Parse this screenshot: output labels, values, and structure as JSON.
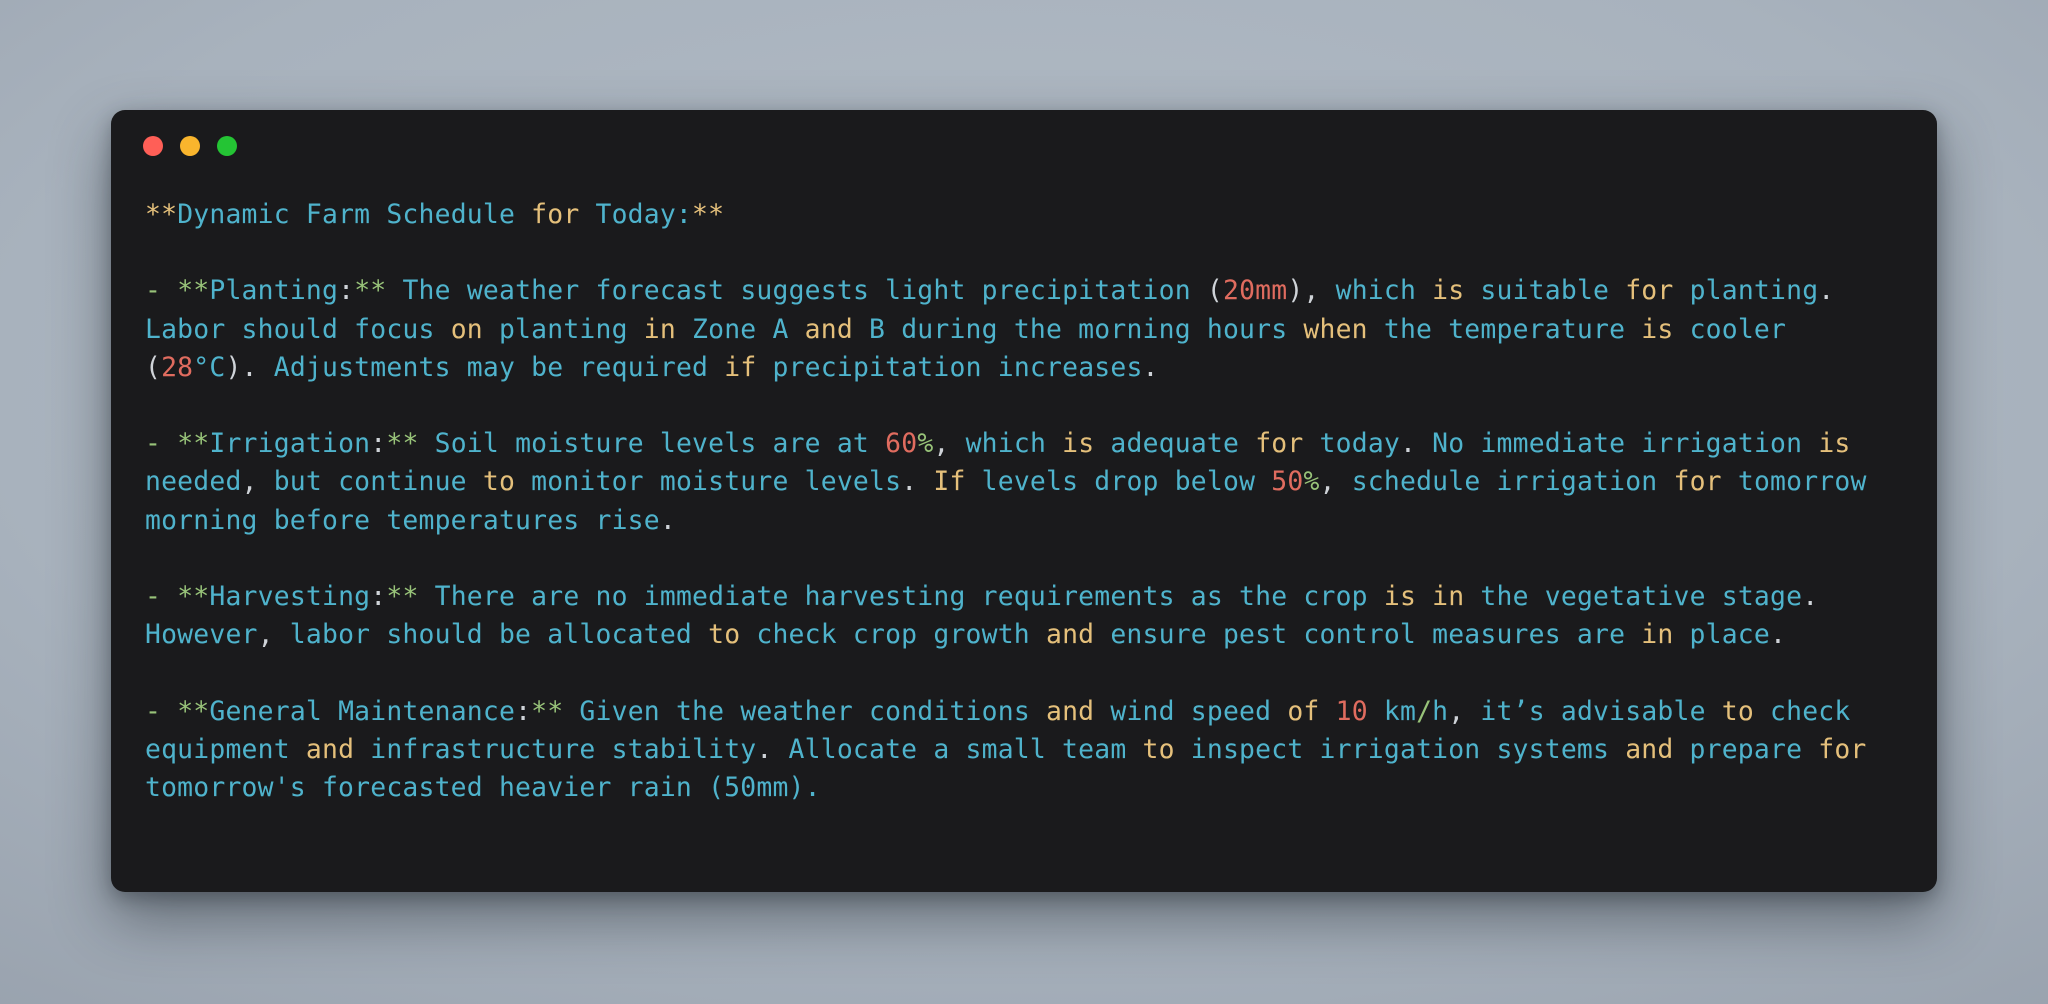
{
  "window": {
    "title": "",
    "controls": [
      {
        "name": "close-button",
        "color": "#ff5f57"
      },
      {
        "name": "minimize-button",
        "color": "#f9b52d"
      },
      {
        "name": "maximize-button",
        "color": "#24c434"
      }
    ]
  },
  "theme": {
    "background": "#1a1a1c",
    "desktop": "#a8b2bd",
    "text": "#4fb3cc",
    "keyword": "#e5c07b",
    "accent_green": "#98c379",
    "number": "#e06c5f",
    "punctuation": "#cfd3d8"
  },
  "terminal": {
    "lines": [
      {
        "id": "heading",
        "tokens": [
          {
            "text": "**",
            "cls": "t-kw"
          },
          {
            "text": "Dynamic Farm Schedule ",
            "cls": "t-txt"
          },
          {
            "text": "for",
            "cls": "t-kw"
          },
          {
            "text": " Today:",
            "cls": "t-txt"
          },
          {
            "text": "**",
            "cls": "t-kw"
          }
        ]
      },
      {
        "id": "blank-1",
        "blank": true
      },
      {
        "id": "planting",
        "tokens": [
          {
            "text": "- ",
            "cls": "t-grn"
          },
          {
            "text": "**",
            "cls": "t-grn"
          },
          {
            "text": "Planting",
            "cls": "t-txt"
          },
          {
            "text": ":",
            "cls": "t-pun"
          },
          {
            "text": "**",
            "cls": "t-grn"
          },
          {
            "text": " The weather forecast suggests light precipitation ",
            "cls": "t-txt"
          },
          {
            "text": "(",
            "cls": "t-pun"
          },
          {
            "text": "20mm",
            "cls": "t-num"
          },
          {
            "text": "), ",
            "cls": "t-pun"
          },
          {
            "text": "which ",
            "cls": "t-txt"
          },
          {
            "text": "is",
            "cls": "t-kw"
          },
          {
            "text": " suitable ",
            "cls": "t-txt"
          },
          {
            "text": "for",
            "cls": "t-kw"
          },
          {
            "text": " planting",
            "cls": "t-txt"
          },
          {
            "text": ".",
            "cls": "t-pun"
          },
          {
            "text": " Labor should focus ",
            "cls": "t-txt"
          },
          {
            "text": "on",
            "cls": "t-kw"
          },
          {
            "text": " planting ",
            "cls": "t-txt"
          },
          {
            "text": "in",
            "cls": "t-kw"
          },
          {
            "text": " Zone A ",
            "cls": "t-txt"
          },
          {
            "text": "and",
            "cls": "t-kw"
          },
          {
            "text": " B during the morning hours ",
            "cls": "t-txt"
          },
          {
            "text": "when",
            "cls": "t-kw"
          },
          {
            "text": " the temperature ",
            "cls": "t-txt"
          },
          {
            "text": "is",
            "cls": "t-kw"
          },
          {
            "text": " cooler ",
            "cls": "t-txt"
          },
          {
            "text": "(",
            "cls": "t-pun"
          },
          {
            "text": "28",
            "cls": "t-num"
          },
          {
            "text": "°C",
            "cls": "t-txt"
          },
          {
            "text": ").",
            "cls": "t-pun"
          },
          {
            "text": " Adjustments may be required ",
            "cls": "t-txt"
          },
          {
            "text": "if",
            "cls": "t-kw"
          },
          {
            "text": " precipitation increases",
            "cls": "t-txt"
          },
          {
            "text": ".",
            "cls": "t-pun"
          }
        ]
      },
      {
        "id": "blank-2",
        "blank": true
      },
      {
        "id": "irrigation",
        "tokens": [
          {
            "text": "- ",
            "cls": "t-grn"
          },
          {
            "text": "**",
            "cls": "t-grn"
          },
          {
            "text": "Irrigation",
            "cls": "t-txt"
          },
          {
            "text": ":",
            "cls": "t-pun"
          },
          {
            "text": "**",
            "cls": "t-grn"
          },
          {
            "text": " Soil moisture levels are at ",
            "cls": "t-txt"
          },
          {
            "text": "60",
            "cls": "t-num"
          },
          {
            "text": "%",
            "cls": "t-grn"
          },
          {
            "text": ", ",
            "cls": "t-pun"
          },
          {
            "text": "which ",
            "cls": "t-txt"
          },
          {
            "text": "is",
            "cls": "t-kw"
          },
          {
            "text": " adequate ",
            "cls": "t-txt"
          },
          {
            "text": "for",
            "cls": "t-kw"
          },
          {
            "text": " today",
            "cls": "t-txt"
          },
          {
            "text": ".",
            "cls": "t-pun"
          },
          {
            "text": " No immediate irrigation ",
            "cls": "t-txt"
          },
          {
            "text": "is",
            "cls": "t-kw"
          },
          {
            "text": " needed",
            "cls": "t-txt"
          },
          {
            "text": ",",
            "cls": "t-pun"
          },
          {
            "text": " but continue ",
            "cls": "t-txt"
          },
          {
            "text": "to",
            "cls": "t-kw"
          },
          {
            "text": " monitor moisture levels",
            "cls": "t-txt"
          },
          {
            "text": ".",
            "cls": "t-pun"
          },
          {
            "text": " ",
            "cls": "t-txt"
          },
          {
            "text": "If",
            "cls": "t-kw"
          },
          {
            "text": " levels drop below ",
            "cls": "t-txt"
          },
          {
            "text": "50",
            "cls": "t-num"
          },
          {
            "text": "%",
            "cls": "t-grn"
          },
          {
            "text": ", ",
            "cls": "t-pun"
          },
          {
            "text": "schedule irrigation ",
            "cls": "t-txt"
          },
          {
            "text": "for",
            "cls": "t-kw"
          },
          {
            "text": " tomorrow morning before temperatures rise",
            "cls": "t-txt"
          },
          {
            "text": ".",
            "cls": "t-pun"
          }
        ]
      },
      {
        "id": "blank-3",
        "blank": true
      },
      {
        "id": "harvesting",
        "tokens": [
          {
            "text": "- ",
            "cls": "t-grn"
          },
          {
            "text": "**",
            "cls": "t-grn"
          },
          {
            "text": "Harvesting",
            "cls": "t-txt"
          },
          {
            "text": ":",
            "cls": "t-pun"
          },
          {
            "text": "**",
            "cls": "t-grn"
          },
          {
            "text": " There are no immediate harvesting requirements as the crop ",
            "cls": "t-txt"
          },
          {
            "text": "is",
            "cls": "t-kw"
          },
          {
            "text": " ",
            "cls": "t-txt"
          },
          {
            "text": "in",
            "cls": "t-kw"
          },
          {
            "text": " the vegetative stage",
            "cls": "t-txt"
          },
          {
            "text": ".",
            "cls": "t-pun"
          },
          {
            "text": " However",
            "cls": "t-txt"
          },
          {
            "text": ",",
            "cls": "t-pun"
          },
          {
            "text": " labor should be allocated ",
            "cls": "t-txt"
          },
          {
            "text": "to",
            "cls": "t-kw"
          },
          {
            "text": " check crop growth ",
            "cls": "t-txt"
          },
          {
            "text": "and",
            "cls": "t-kw"
          },
          {
            "text": " ensure pest control measures are ",
            "cls": "t-txt"
          },
          {
            "text": "in",
            "cls": "t-kw"
          },
          {
            "text": " place",
            "cls": "t-txt"
          },
          {
            "text": ".",
            "cls": "t-pun"
          }
        ]
      },
      {
        "id": "blank-4",
        "blank": true
      },
      {
        "id": "general-maintenance",
        "tokens": [
          {
            "text": "- ",
            "cls": "t-grn"
          },
          {
            "text": "**",
            "cls": "t-grn"
          },
          {
            "text": "General Maintenance",
            "cls": "t-txt"
          },
          {
            "text": ":",
            "cls": "t-pun"
          },
          {
            "text": "**",
            "cls": "t-grn"
          },
          {
            "text": " Given the weather conditions ",
            "cls": "t-txt"
          },
          {
            "text": "and",
            "cls": "t-kw"
          },
          {
            "text": " wind speed ",
            "cls": "t-txt"
          },
          {
            "text": "of",
            "cls": "t-kw"
          },
          {
            "text": " ",
            "cls": "t-txt"
          },
          {
            "text": "10",
            "cls": "t-num"
          },
          {
            "text": " km",
            "cls": "t-txt"
          },
          {
            "text": "/",
            "cls": "t-grn"
          },
          {
            "text": "h",
            "cls": "t-txt"
          },
          {
            "text": ",",
            "cls": "t-pun"
          },
          {
            "text": " it’s advisable ",
            "cls": "t-txt"
          },
          {
            "text": "to",
            "cls": "t-kw"
          },
          {
            "text": " check equipment ",
            "cls": "t-txt"
          },
          {
            "text": "and",
            "cls": "t-kw"
          },
          {
            "text": " infrastructure stability",
            "cls": "t-txt"
          },
          {
            "text": ".",
            "cls": "t-pun"
          },
          {
            "text": " Allocate a small team ",
            "cls": "t-txt"
          },
          {
            "text": "to",
            "cls": "t-kw"
          },
          {
            "text": " inspect irrigation systems ",
            "cls": "t-txt"
          },
          {
            "text": "and",
            "cls": "t-kw"
          },
          {
            "text": " prepare ",
            "cls": "t-txt"
          },
          {
            "text": "for",
            "cls": "t-kw"
          },
          {
            "text": " tomorrow's forecasted heavier rain (50mm).",
            "cls": "t-txt"
          }
        ]
      }
    ]
  }
}
